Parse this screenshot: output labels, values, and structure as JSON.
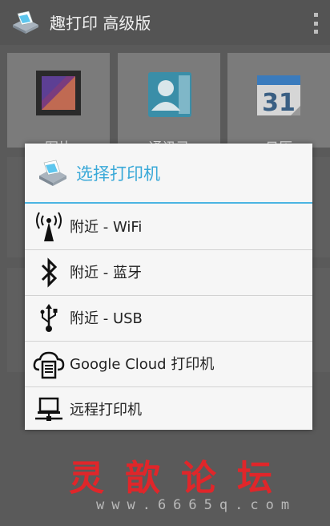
{
  "app": {
    "title": "趣打印 高级版",
    "icon": "printer-app-icon"
  },
  "grid": {
    "tiles": [
      {
        "label": "图片",
        "icon": "photo-icon"
      },
      {
        "label": "通讯录",
        "icon": "contacts-icon"
      },
      {
        "label": "日历",
        "icon": "calendar-icon",
        "day": "31"
      }
    ]
  },
  "dialog": {
    "title": "选择打印机",
    "options": [
      {
        "label": "附近 - WiFi",
        "icon": "wifi-tower-icon"
      },
      {
        "label": "附近 - 蓝牙",
        "icon": "bluetooth-icon"
      },
      {
        "label": "附近 - USB",
        "icon": "usb-icon"
      },
      {
        "label": "Google Cloud 打印机",
        "icon": "cloud-print-icon"
      },
      {
        "label": "远程打印机",
        "icon": "remote-computer-icon"
      }
    ]
  },
  "watermark": {
    "title": "灵歆论坛",
    "url": "www.6665q.com"
  },
  "colors": {
    "accent": "#3aa9d8",
    "watermark": "#e0262a"
  }
}
